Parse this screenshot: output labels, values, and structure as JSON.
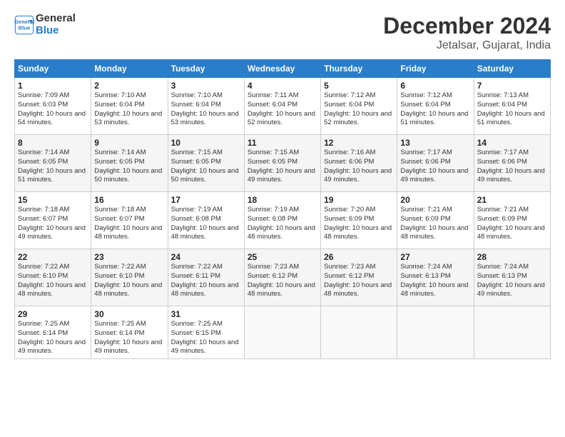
{
  "header": {
    "logo_line1": "General",
    "logo_line2": "Blue",
    "title": "December 2024",
    "subtitle": "Jetalsar, Gujarat, India"
  },
  "weekdays": [
    "Sunday",
    "Monday",
    "Tuesday",
    "Wednesday",
    "Thursday",
    "Friday",
    "Saturday"
  ],
  "weeks": [
    [
      {
        "day": "1",
        "sunrise": "Sunrise: 7:09 AM",
        "sunset": "Sunset: 6:03 PM",
        "daylight": "Daylight: 10 hours and 54 minutes."
      },
      {
        "day": "2",
        "sunrise": "Sunrise: 7:10 AM",
        "sunset": "Sunset: 6:04 PM",
        "daylight": "Daylight: 10 hours and 53 minutes."
      },
      {
        "day": "3",
        "sunrise": "Sunrise: 7:10 AM",
        "sunset": "Sunset: 6:04 PM",
        "daylight": "Daylight: 10 hours and 53 minutes."
      },
      {
        "day": "4",
        "sunrise": "Sunrise: 7:11 AM",
        "sunset": "Sunset: 6:04 PM",
        "daylight": "Daylight: 10 hours and 52 minutes."
      },
      {
        "day": "5",
        "sunrise": "Sunrise: 7:12 AM",
        "sunset": "Sunset: 6:04 PM",
        "daylight": "Daylight: 10 hours and 52 minutes."
      },
      {
        "day": "6",
        "sunrise": "Sunrise: 7:12 AM",
        "sunset": "Sunset: 6:04 PM",
        "daylight": "Daylight: 10 hours and 51 minutes."
      },
      {
        "day": "7",
        "sunrise": "Sunrise: 7:13 AM",
        "sunset": "Sunset: 6:04 PM",
        "daylight": "Daylight: 10 hours and 51 minutes."
      }
    ],
    [
      {
        "day": "8",
        "sunrise": "Sunrise: 7:14 AM",
        "sunset": "Sunset: 6:05 PM",
        "daylight": "Daylight: 10 hours and 51 minutes."
      },
      {
        "day": "9",
        "sunrise": "Sunrise: 7:14 AM",
        "sunset": "Sunset: 6:05 PM",
        "daylight": "Daylight: 10 hours and 50 minutes."
      },
      {
        "day": "10",
        "sunrise": "Sunrise: 7:15 AM",
        "sunset": "Sunset: 6:05 PM",
        "daylight": "Daylight: 10 hours and 50 minutes."
      },
      {
        "day": "11",
        "sunrise": "Sunrise: 7:15 AM",
        "sunset": "Sunset: 6:05 PM",
        "daylight": "Daylight: 10 hours and 49 minutes."
      },
      {
        "day": "12",
        "sunrise": "Sunrise: 7:16 AM",
        "sunset": "Sunset: 6:06 PM",
        "daylight": "Daylight: 10 hours and 49 minutes."
      },
      {
        "day": "13",
        "sunrise": "Sunrise: 7:17 AM",
        "sunset": "Sunset: 6:06 PM",
        "daylight": "Daylight: 10 hours and 49 minutes."
      },
      {
        "day": "14",
        "sunrise": "Sunrise: 7:17 AM",
        "sunset": "Sunset: 6:06 PM",
        "daylight": "Daylight: 10 hours and 49 minutes."
      }
    ],
    [
      {
        "day": "15",
        "sunrise": "Sunrise: 7:18 AM",
        "sunset": "Sunset: 6:07 PM",
        "daylight": "Daylight: 10 hours and 49 minutes."
      },
      {
        "day": "16",
        "sunrise": "Sunrise: 7:18 AM",
        "sunset": "Sunset: 6:07 PM",
        "daylight": "Daylight: 10 hours and 48 minutes."
      },
      {
        "day": "17",
        "sunrise": "Sunrise: 7:19 AM",
        "sunset": "Sunset: 6:08 PM",
        "daylight": "Daylight: 10 hours and 48 minutes."
      },
      {
        "day": "18",
        "sunrise": "Sunrise: 7:19 AM",
        "sunset": "Sunset: 6:08 PM",
        "daylight": "Daylight: 10 hours and 48 minutes."
      },
      {
        "day": "19",
        "sunrise": "Sunrise: 7:20 AM",
        "sunset": "Sunset: 6:09 PM",
        "daylight": "Daylight: 10 hours and 48 minutes."
      },
      {
        "day": "20",
        "sunrise": "Sunrise: 7:21 AM",
        "sunset": "Sunset: 6:09 PM",
        "daylight": "Daylight: 10 hours and 48 minutes."
      },
      {
        "day": "21",
        "sunrise": "Sunrise: 7:21 AM",
        "sunset": "Sunset: 6:09 PM",
        "daylight": "Daylight: 10 hours and 48 minutes."
      }
    ],
    [
      {
        "day": "22",
        "sunrise": "Sunrise: 7:22 AM",
        "sunset": "Sunset: 6:10 PM",
        "daylight": "Daylight: 10 hours and 48 minutes."
      },
      {
        "day": "23",
        "sunrise": "Sunrise: 7:22 AM",
        "sunset": "Sunset: 6:10 PM",
        "daylight": "Daylight: 10 hours and 48 minutes."
      },
      {
        "day": "24",
        "sunrise": "Sunrise: 7:22 AM",
        "sunset": "Sunset: 6:11 PM",
        "daylight": "Daylight: 10 hours and 48 minutes."
      },
      {
        "day": "25",
        "sunrise": "Sunrise: 7:23 AM",
        "sunset": "Sunset: 6:12 PM",
        "daylight": "Daylight: 10 hours and 48 minutes."
      },
      {
        "day": "26",
        "sunrise": "Sunrise: 7:23 AM",
        "sunset": "Sunset: 6:12 PM",
        "daylight": "Daylight: 10 hours and 48 minutes."
      },
      {
        "day": "27",
        "sunrise": "Sunrise: 7:24 AM",
        "sunset": "Sunset: 6:13 PM",
        "daylight": "Daylight: 10 hours and 48 minutes."
      },
      {
        "day": "28",
        "sunrise": "Sunrise: 7:24 AM",
        "sunset": "Sunset: 6:13 PM",
        "daylight": "Daylight: 10 hours and 49 minutes."
      }
    ],
    [
      {
        "day": "29",
        "sunrise": "Sunrise: 7:25 AM",
        "sunset": "Sunset: 6:14 PM",
        "daylight": "Daylight: 10 hours and 49 minutes."
      },
      {
        "day": "30",
        "sunrise": "Sunrise: 7:25 AM",
        "sunset": "Sunset: 6:14 PM",
        "daylight": "Daylight: 10 hours and 49 minutes."
      },
      {
        "day": "31",
        "sunrise": "Sunrise: 7:25 AM",
        "sunset": "Sunset: 6:15 PM",
        "daylight": "Daylight: 10 hours and 49 minutes."
      },
      null,
      null,
      null,
      null
    ]
  ]
}
